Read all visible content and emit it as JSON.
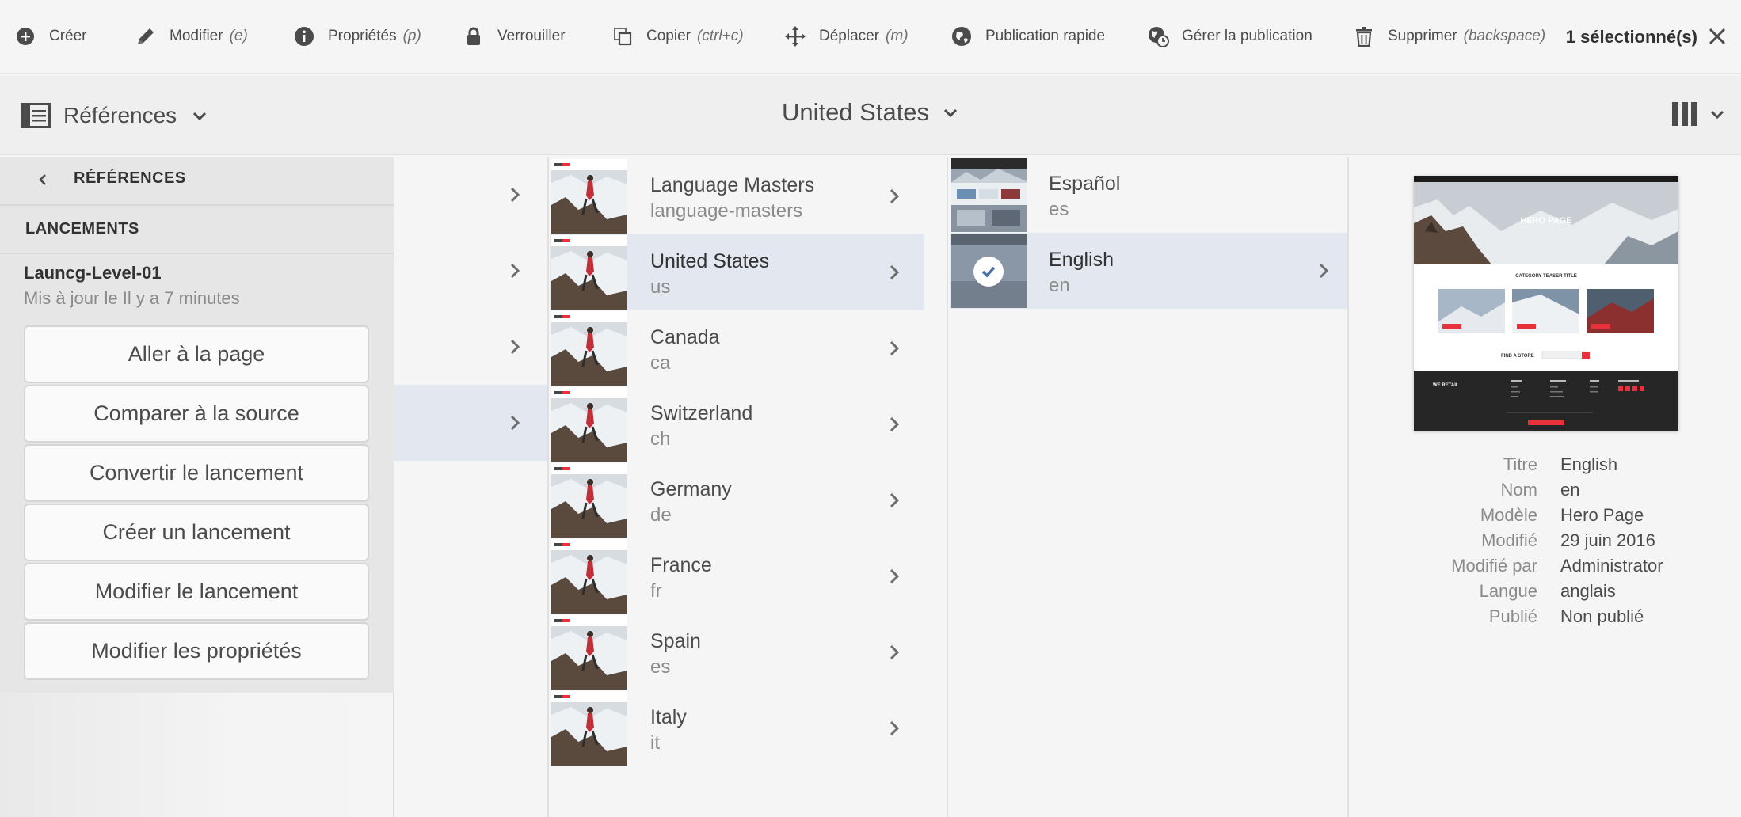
{
  "actionbar": {
    "items": [
      {
        "label": "Créer",
        "hint": "",
        "icon": "add-circle-icon"
      },
      {
        "label": "Modifier",
        "hint": "(e)",
        "icon": "pencil-icon"
      },
      {
        "label": "Propriétés",
        "hint": "(p)",
        "icon": "info-icon"
      },
      {
        "label": "Verrouiller",
        "hint": "",
        "icon": "lock-icon"
      },
      {
        "label": "Copier",
        "hint": "(ctrl+c)",
        "icon": "copy-icon"
      },
      {
        "label": "Déplacer",
        "hint": "(m)",
        "icon": "move-icon"
      },
      {
        "label": "Publication rapide",
        "hint": "",
        "icon": "globe-icon"
      },
      {
        "label": "Gérer la publication",
        "hint": "",
        "icon": "globe-clock-icon"
      },
      {
        "label": "Supprimer",
        "hint": "(backspace)",
        "icon": "trash-icon"
      }
    ],
    "selected_count": "1 sélectionné(s)"
  },
  "header": {
    "rail_label": "Références",
    "location_title": "United States"
  },
  "rail": {
    "heading": "RÉFÉRENCES",
    "section": "LANCEMENTS",
    "launch": {
      "name": "Launcg-Level-01",
      "updated": "Mis à jour le Il y a 7 minutes"
    },
    "buttons": [
      "Aller à la page",
      "Comparer à la source",
      "Convertir le lancement",
      "Créer un lancement",
      "Modifier le lancement",
      "Modifier les propriétés"
    ]
  },
  "columns": {
    "col1": [
      {
        "title": "Language Masters",
        "name": "language-masters"
      },
      {
        "title": "United States",
        "name": "us"
      },
      {
        "title": "Canada",
        "name": "ca"
      },
      {
        "title": "Switzerland",
        "name": "ch"
      },
      {
        "title": "Germany",
        "name": "de"
      },
      {
        "title": "France",
        "name": "fr"
      },
      {
        "title": "Spain",
        "name": "es"
      },
      {
        "title": "Italy",
        "name": "it"
      }
    ],
    "col2": [
      {
        "title": "Español",
        "name": "es"
      },
      {
        "title": "English",
        "name": "en"
      }
    ]
  },
  "preview": {
    "thumb_text": {
      "brand": "WE.RETAIL",
      "hero": "HERO PAGE",
      "teaser": "CATEGORY TEASER TITLE",
      "store": "FIND A STORE"
    },
    "meta": [
      {
        "label": "Titre",
        "value": "English"
      },
      {
        "label": "Nom",
        "value": "en"
      },
      {
        "label": "Modèle",
        "value": "Hero Page"
      },
      {
        "label": "Modifié",
        "value": "29 juin 2016"
      },
      {
        "label": "Modifié par",
        "value": "Administrator"
      },
      {
        "label": "Langue",
        "value": "anglais"
      },
      {
        "label": "Publié",
        "value": "Non publié"
      }
    ]
  },
  "colors": {
    "active_row": "#e3e7ef",
    "text": "#4b4b4b",
    "muted": "#8a8a8a",
    "brand_red": "#e8313b"
  }
}
